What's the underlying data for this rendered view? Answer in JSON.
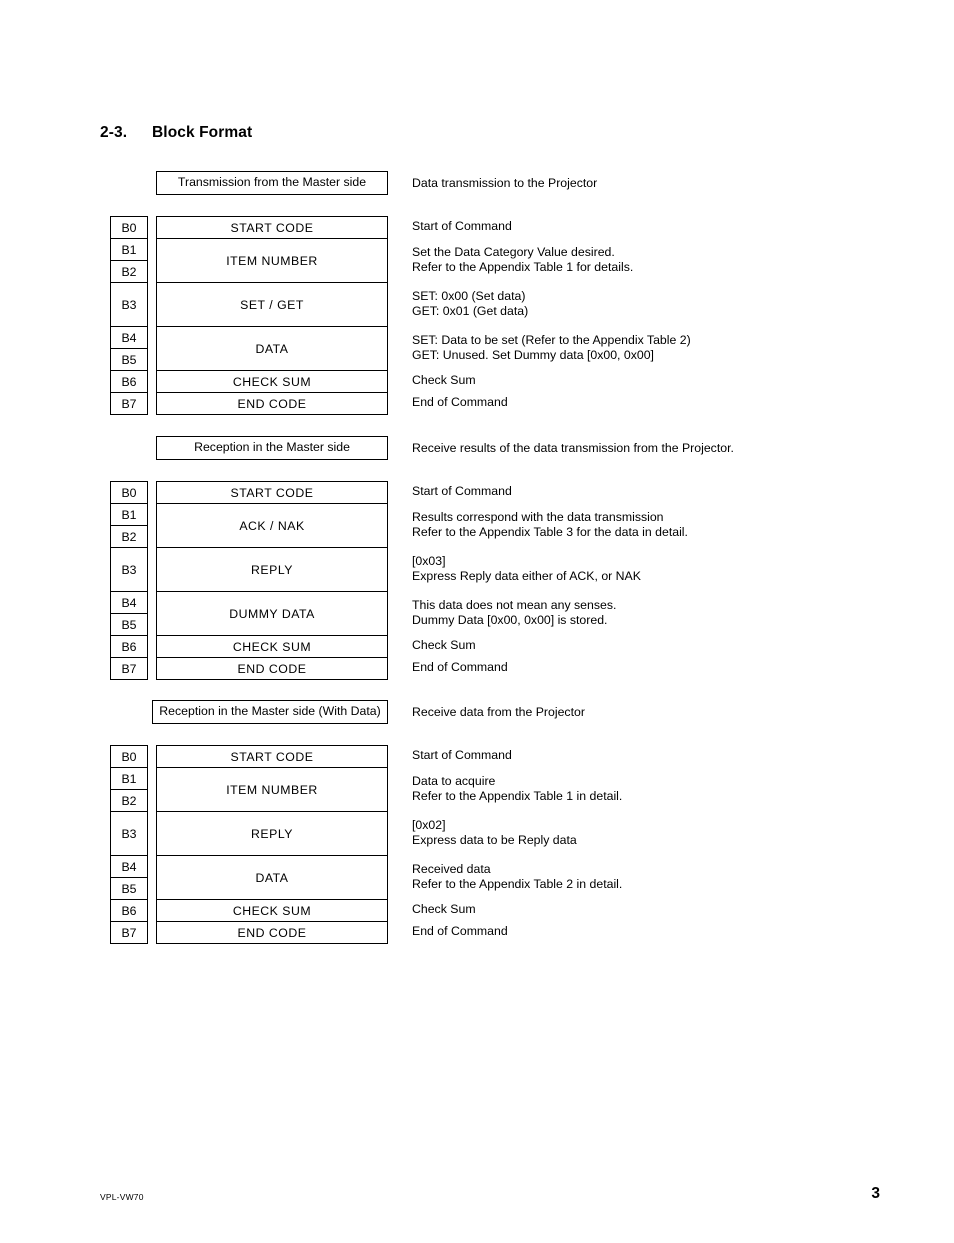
{
  "heading": {
    "number": "2-3.",
    "title": "Block Format"
  },
  "footer": {
    "model": "VPL-VW70",
    "page_number": "3"
  },
  "blocks": [
    {
      "title": "Transmission from the Master side",
      "title_note": "Data transmission to the Projector",
      "rows": [
        {
          "bytes": [
            "B0"
          ],
          "field": "START CODE",
          "notes": [
            "Start of Command"
          ]
        },
        {
          "bytes": [
            "B1",
            "B2"
          ],
          "field": "ITEM NUMBER",
          "notes": [
            "Set the Data Category Value desired.",
            "Refer to the Appendix Table 1 for details."
          ]
        },
        {
          "bytes": [
            "B3"
          ],
          "field": "SET / GET",
          "notes": [
            "SET: 0x00 (Set data)",
            "GET: 0x01 (Get data)"
          ]
        },
        {
          "bytes": [
            "B4",
            "B5"
          ],
          "field": "DATA",
          "notes": [
            "SET: Data to be set (Refer to the Appendix Table 2)",
            "GET: Unused. Set Dummy data [0x00, 0x00]"
          ]
        },
        {
          "bytes": [
            "B6"
          ],
          "field": "CHECK SUM",
          "notes": [
            "Check Sum"
          ]
        },
        {
          "bytes": [
            "B7"
          ],
          "field": "END CODE",
          "notes": [
            "End of Command"
          ]
        }
      ]
    },
    {
      "title": "Reception in the Master side",
      "title_note": "Receive results of the data transmission from the Projector.",
      "rows": [
        {
          "bytes": [
            "B0"
          ],
          "field": "START CODE",
          "notes": [
            "Start of Command"
          ]
        },
        {
          "bytes": [
            "B1",
            "B2"
          ],
          "field": "ACK / NAK",
          "notes": [
            "Results correspond with the data transmission",
            "Refer to the Appendix Table 3 for the data in detail."
          ]
        },
        {
          "bytes": [
            "B3"
          ],
          "field": "REPLY",
          "notes": [
            "[0x03]",
            "Express Reply data either of ACK, or NAK"
          ]
        },
        {
          "bytes": [
            "B4",
            "B5"
          ],
          "field": "DUMMY DATA",
          "notes": [
            "This data does not mean any senses.",
            "Dummy Data [0x00, 0x00] is stored."
          ]
        },
        {
          "bytes": [
            "B6"
          ],
          "field": "CHECK SUM",
          "notes": [
            "Check Sum"
          ]
        },
        {
          "bytes": [
            "B7"
          ],
          "field": "END CODE",
          "notes": [
            "End of Command"
          ]
        }
      ]
    },
    {
      "title": "Reception in the Master side (With Data)",
      "title_note": "Receive data from the Projector",
      "rows": [
        {
          "bytes": [
            "B0"
          ],
          "field": "START CODE",
          "notes": [
            "Start of Command"
          ]
        },
        {
          "bytes": [
            "B1",
            "B2"
          ],
          "field": "ITEM NUMBER",
          "notes": [
            "Data to acquire",
            "Refer to the Appendix Table 1 in detail."
          ]
        },
        {
          "bytes": [
            "B3"
          ],
          "field": "REPLY",
          "notes": [
            "[0x02]",
            "Express data to be Reply data"
          ]
        },
        {
          "bytes": [
            "B4",
            "B5"
          ],
          "field": "DATA",
          "notes": [
            "Received data",
            "Refer to the Appendix Table 2 in detail."
          ]
        },
        {
          "bytes": [
            "B6"
          ],
          "field": "CHECK SUM",
          "notes": [
            "Check Sum"
          ]
        },
        {
          "bytes": [
            "B7"
          ],
          "field": "END CODE",
          "notes": [
            "End of Command"
          ]
        }
      ]
    }
  ]
}
